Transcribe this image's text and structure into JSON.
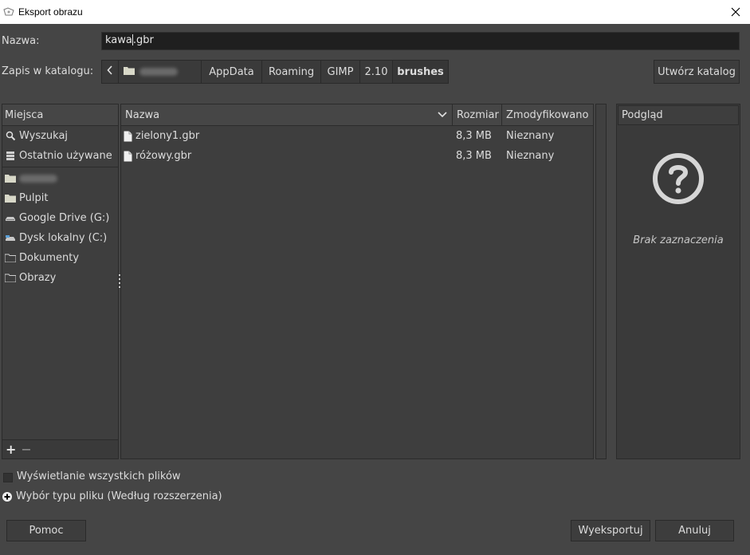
{
  "window": {
    "title": "Eksport obrazu"
  },
  "name_field": {
    "label": "Nazwa:",
    "value_before_caret": "kawa",
    "value_after_caret": ".gbr"
  },
  "location": {
    "label": "Zapis w katalogu:",
    "crumbs": [
      "AppData",
      "Roaming",
      "GIMP",
      "2.10"
    ],
    "current": "brushes"
  },
  "create_folder_label": "Utwórz katalog",
  "places": {
    "header": "Miejsca",
    "items": [
      {
        "label": "Wyszukaj",
        "icon": "search-icon"
      },
      {
        "label": "Ostatnio używane",
        "icon": "recent-icon"
      },
      {
        "label": "",
        "icon": "home-folder-icon"
      },
      {
        "label": "Pulpit",
        "icon": "folder-icon"
      },
      {
        "label": "Google Drive (G:)",
        "icon": "drive-icon"
      },
      {
        "label": "Dysk lokalny (C:)",
        "icon": "drive-icon"
      },
      {
        "label": "Dokumenty",
        "icon": "folder-icon"
      },
      {
        "label": "Obrazy",
        "icon": "folder-icon"
      }
    ],
    "add_label": "+",
    "remove_label": "−"
  },
  "files": {
    "columns": {
      "name": "Nazwa",
      "size": "Rozmiar",
      "modified": "Zmodyfikowano"
    },
    "rows": [
      {
        "name": "zielony1.gbr",
        "size": "8,3 MB",
        "modified": "Nieznany"
      },
      {
        "name": "różowy.gbr",
        "size": "8,3 MB",
        "modified": "Nieznany"
      }
    ]
  },
  "preview": {
    "header": "Podgląd",
    "empty_text": "Brak zaznaczenia"
  },
  "show_all_files_label": "Wyświetlanie wszystkich plików",
  "file_type_label": "Wybór typu pliku (Według rozszerzenia)",
  "buttons": {
    "help": "Pomoc",
    "export": "Wyeksportuj",
    "cancel": "Anuluj"
  },
  "colors": {
    "background": "#454545",
    "field": "#1f1f1f",
    "text": "#dcdcdc"
  }
}
